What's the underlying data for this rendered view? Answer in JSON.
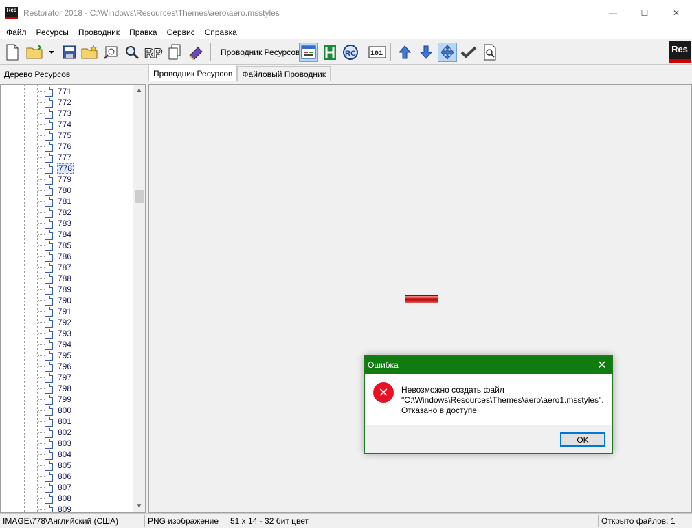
{
  "window": {
    "icon_text": "Res",
    "title": "Restorator 2018 - C:\\Windows\\Resources\\Themes\\aero\\aero.msstyles",
    "minimize": "—",
    "maximize": "☐",
    "close": "✕"
  },
  "menu": [
    "Файл",
    "Ресурсы",
    "Проводник",
    "Правка",
    "Сервис",
    "Справка"
  ],
  "toolbar": {
    "explorer_label": "Проводник Ресурсов:",
    "logo_text": "Res"
  },
  "left_panel": {
    "header": "Дерево Ресурсов",
    "items": [
      "771",
      "772",
      "773",
      "774",
      "775",
      "776",
      "777",
      "778",
      "779",
      "780",
      "781",
      "782",
      "783",
      "784",
      "785",
      "786",
      "787",
      "788",
      "789",
      "790",
      "791",
      "792",
      "793",
      "794",
      "795",
      "796",
      "797",
      "798",
      "799",
      "800",
      "801",
      "802",
      "803",
      "804",
      "805",
      "806",
      "807",
      "808",
      "809"
    ],
    "selected": "778"
  },
  "tabs": [
    {
      "label": "Проводник Ресурсов",
      "active": true
    },
    {
      "label": "Файловый Проводник",
      "active": false
    }
  ],
  "status": {
    "path": "IMAGE\\778\\Английский (США)",
    "type": "PNG изображение",
    "dims": "51 x 14 - 32 бит цвет",
    "open_files": "Открыто файлов: 1"
  },
  "dialog": {
    "title": "Ошибка",
    "close": "✕",
    "icon": "✕",
    "line1": "Невозможно создать файл",
    "line2": "\"C:\\Windows\\Resources\\Themes\\aero\\aero1.msstyles\".",
    "line3": "Отказано в доступе",
    "ok": "OK"
  },
  "colors": {
    "dialog_title": "#107c10",
    "error_icon": "#e81123",
    "focus_border": "#0078d7"
  }
}
